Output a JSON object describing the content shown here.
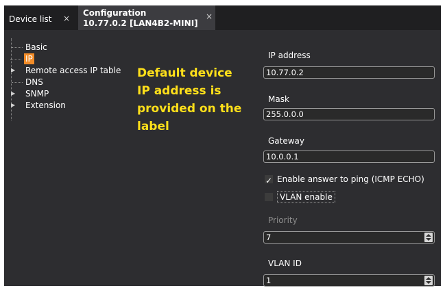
{
  "tabs": {
    "device_list": "Device list",
    "config_line1": "Configuration",
    "config_line2": "10.77.0.2 [LAN4B2-MINI]",
    "close": "×"
  },
  "tree": {
    "basic": "Basic",
    "ip": "IP",
    "remote": "Remote access IP table",
    "dns": "DNS",
    "snmp": "SNMP",
    "extension": "Extension"
  },
  "annotation": {
    "line1": "Default device",
    "line2": "IP address is",
    "line3": "provided on the",
    "line4": "label"
  },
  "props": {
    "ip_label": "IP address",
    "ip_value": "10.77.0.2",
    "mask_label": "Mask",
    "mask_value": "255.0.0.0",
    "gateway_label": "Gateway",
    "gateway_value": "10.0.0.1",
    "ping_label": "Enable answer to ping (ICMP ECHO)",
    "ping_checked": true,
    "vlan_label": "VLAN enable",
    "vlan_checked": false,
    "priority_label": "Priority",
    "priority_value": "7",
    "vlanid_label": "VLAN ID",
    "vlanid_value": "1"
  },
  "colors": {
    "accent_selected": "#f28c28",
    "annotation": "#ffe01a",
    "background": "#2d2d30"
  }
}
